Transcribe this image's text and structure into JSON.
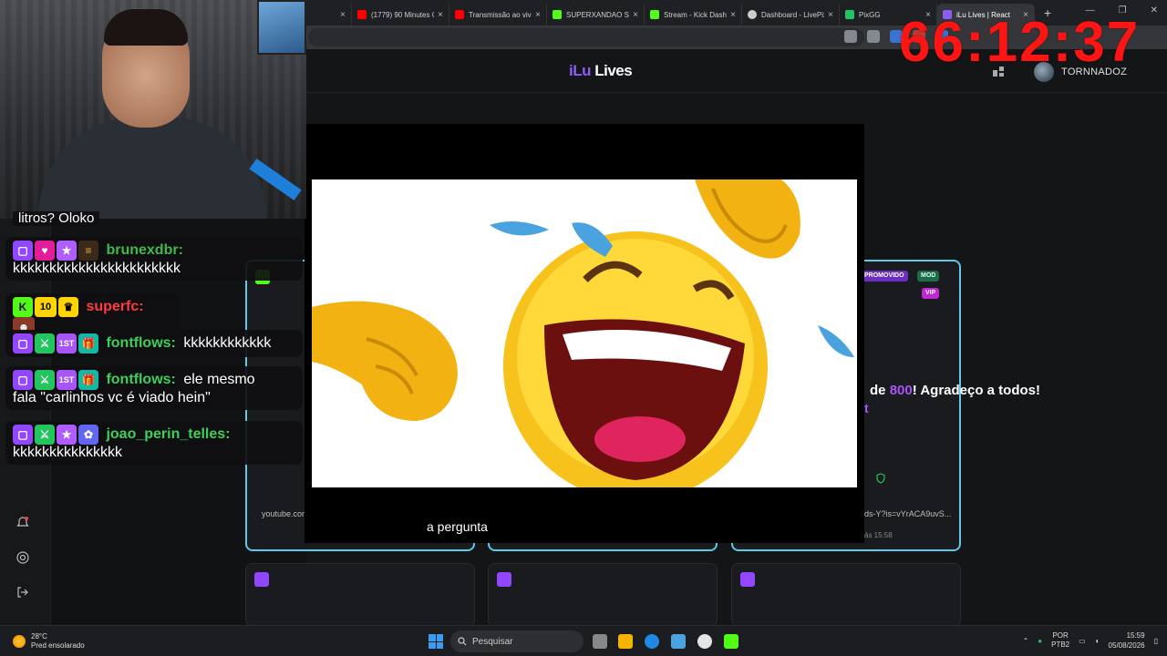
{
  "browser": {
    "tabs": [
      {
        "title": "",
        "favicon_color": "#888888",
        "active": false
      },
      {
        "title": "(1779) 90 Minutes C",
        "favicon_color": "#ff0000",
        "active": false
      },
      {
        "title": "Transmissão ao vivo",
        "favicon_color": "#ff0000",
        "active": false
      },
      {
        "title": "SUPERXANDAO Str",
        "favicon_color": "#53fc18",
        "active": false
      },
      {
        "title": "Stream - Kick Dashb",
        "favicon_color": "#53fc18",
        "active": false
      },
      {
        "title": "Dashboard - LivePix",
        "favicon_color": "#cccccc",
        "active": false
      },
      {
        "title": "PixGG",
        "favicon_color": "#22c55e",
        "active": false
      },
      {
        "title": "iLu Lives | React",
        "favicon_color": "#8b5cf6",
        "active": true
      }
    ],
    "new_tab": "+",
    "close_glyph": "×",
    "window_controls": [
      "—",
      "❐",
      "✕"
    ]
  },
  "site": {
    "logo_part1": "iLu",
    "logo_part2": "Lives",
    "username": "TORNNADOZ"
  },
  "timer": "66:12:37",
  "chat": {
    "top_fragment": "litros? Oloko",
    "messages": [
      {
        "user": "brunexdbr:",
        "text": "kkkkkkkkkkkkkkkkkkkkkkk",
        "color": "#3fb94a"
      },
      {
        "user": "superfc:",
        "text": "",
        "color": "#ff3d3d"
      },
      {
        "user": "fontflows:",
        "text": "kkkkkkkkkkkk",
        "color": "#3ecf5a"
      },
      {
        "user": "fontflows:",
        "text": "ele mesmo",
        "text2": "fala \"carlinhos vc é viado hein\"",
        "color": "#3ecf5a"
      },
      {
        "user": "joao_perin_telles:",
        "text": "kkkkkkkkkkkkkkk",
        "color": "#3ecf5a"
      }
    ],
    "badge_num": "10",
    "badge_first": "1ST"
  },
  "cards": {
    "card1_footer": "youtube.com",
    "card3_footer": "ds-Y?is=vYrACA9uvS...",
    "card3_time": "ás 15:58",
    "pill_promo": "PROMOVIDO",
    "pill_mod": "MOD",
    "pill_vip": "VIP",
    "thanks_prefix": "de ",
    "thanks_num": "800",
    "thanks_suffix": "! Agradeço a todos!",
    "thanks_frag": "t"
  },
  "video": {
    "caption": "a pergunta"
  },
  "taskbar": {
    "temp": "28°C",
    "weather": "Pred ensolarado",
    "search_placeholder": "Pesquisar",
    "lang1": "POR",
    "lang2": "PTB2",
    "time": "15:59",
    "date": "05/08/2026"
  }
}
